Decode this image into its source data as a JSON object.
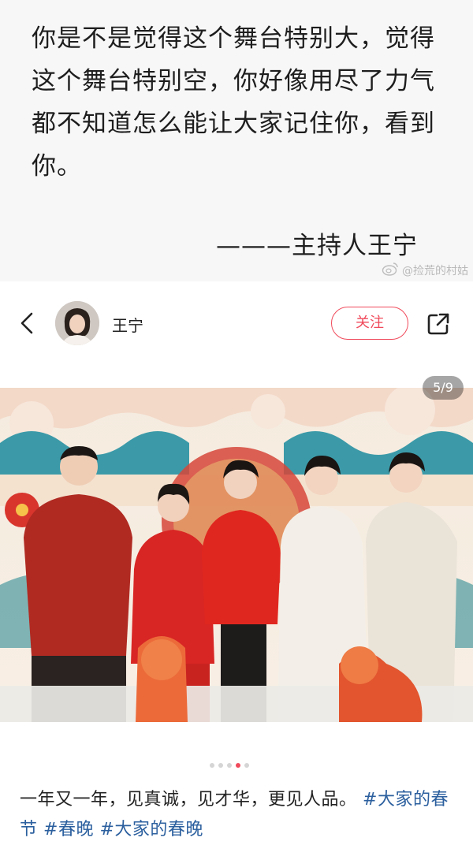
{
  "quote": {
    "text": "你是不是觉得这个舞台特别大，觉得这个舞台特别空，你好像用尽了力气都不知道怎么能让大家记住你，看到你。",
    "author": "———主持人王宁"
  },
  "watermark": {
    "text": "@捡荒的村姑"
  },
  "profile": {
    "name": "王宁",
    "follow_label": "关注"
  },
  "gallery": {
    "counter": "5/9",
    "dots": [
      {
        "active": false
      },
      {
        "active": false
      },
      {
        "active": false
      },
      {
        "active": true
      },
      {
        "active": false
      }
    ]
  },
  "post": {
    "caption": "一年又一年，见真诚，见才华，更见人品。",
    "hashtags": [
      "#大家的春节",
      "#春晚",
      "#大家的春晚"
    ]
  },
  "colors": {
    "accent": "#f04a5b",
    "hashtag": "#2b5f9e"
  },
  "icons": [
    "back-icon",
    "share-icon",
    "weibo-icon"
  ]
}
